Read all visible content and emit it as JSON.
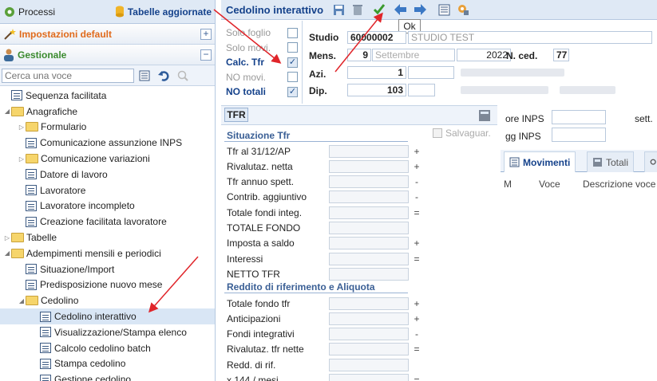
{
  "left": {
    "processi": "Processi",
    "tabelle_aggiornate": "Tabelle aggiornate",
    "sections": [
      {
        "label": "Impostazioni default",
        "color": "#e06a1b",
        "toggle": "+"
      },
      {
        "label": "Gestionale",
        "color": "#3a8a2e",
        "toggle": "−"
      }
    ],
    "search_placeholder": "Cerca una voce",
    "tree": [
      {
        "label": "Sequenza facilitata",
        "type": "doc",
        "level": 0,
        "exp": ""
      },
      {
        "label": "Anagrafiche",
        "type": "folder",
        "level": 0,
        "exp": "◢"
      },
      {
        "label": "Formulario",
        "type": "folder",
        "level": 1,
        "exp": "▷"
      },
      {
        "label": "Comunicazione assunzione INPS",
        "type": "doc",
        "level": 1,
        "exp": ""
      },
      {
        "label": "Comunicazione variazioni",
        "type": "folder",
        "level": 1,
        "exp": "▷"
      },
      {
        "label": "Datore di lavoro",
        "type": "doc",
        "level": 1,
        "exp": ""
      },
      {
        "label": "Lavoratore",
        "type": "doc",
        "level": 1,
        "exp": ""
      },
      {
        "label": "Lavoratore incompleto",
        "type": "doc",
        "level": 1,
        "exp": ""
      },
      {
        "label": "Creazione facilitata lavoratore",
        "type": "doc",
        "level": 1,
        "exp": ""
      },
      {
        "label": "Tabelle",
        "type": "folder",
        "level": 0,
        "exp": "▷"
      },
      {
        "label": "Adempimenti mensili e periodici",
        "type": "folder",
        "level": 0,
        "exp": "◢"
      },
      {
        "label": "Situazione/Import",
        "type": "doc",
        "level": 1,
        "exp": ""
      },
      {
        "label": "Predisposizione nuovo mese",
        "type": "doc",
        "level": 1,
        "exp": ""
      },
      {
        "label": "Cedolino",
        "type": "folder",
        "level": 1,
        "exp": "◢"
      },
      {
        "label": "Cedolino interattivo",
        "type": "doc",
        "level": 2,
        "exp": "",
        "selected": true
      },
      {
        "label": "Visualizzazione/Stampa elenco",
        "type": "doc",
        "level": 2,
        "exp": ""
      },
      {
        "label": "Calcolo cedolino batch",
        "type": "doc",
        "level": 2,
        "exp": ""
      },
      {
        "label": "Stampa cedolino",
        "type": "doc",
        "level": 2,
        "exp": ""
      },
      {
        "label": "Gestione cedolino",
        "type": "doc",
        "level": 2,
        "exp": ""
      }
    ]
  },
  "toolbar": {
    "title": "Cedolino interattivo",
    "tooltip": "Ok"
  },
  "checks": [
    {
      "label": "Solo foglio",
      "checked": false,
      "bold": false
    },
    {
      "label": "Solo movi.",
      "checked": false,
      "bold": false
    },
    {
      "label": "Calc. Tfr",
      "checked": true,
      "bold": true
    },
    {
      "label": "NO movi.",
      "checked": false,
      "bold": false
    },
    {
      "label": "NO totali",
      "checked": true,
      "bold": true
    }
  ],
  "header": {
    "studio_label": "Studio",
    "studio_code": "60000002",
    "studio_name": "STUDIO TEST",
    "mens_label": "Mens.",
    "month_num": "9",
    "month_name": "Settembre",
    "year": "2022",
    "nced_label": "N. ced.",
    "nced": "77",
    "azi_label": "Azi.",
    "azi": "1",
    "dip_label": "Dip.",
    "dip": "103"
  },
  "panel": {
    "tab": "TFR",
    "salvaguar": "Salvaguar.",
    "group1": "Situazione Tfr",
    "rows1": [
      {
        "label": "Tfr al 31/12/AP",
        "op": "+"
      },
      {
        "label": "Rivalutaz. netta",
        "op": "+"
      },
      {
        "label": "Tfr annuo spett.",
        "op": "-"
      },
      {
        "label": "Contrib. aggiuntivo",
        "op": "-"
      },
      {
        "label": "Totale fondi integ.",
        "op": "="
      },
      {
        "label": "TOTALE FONDO",
        "op": ""
      },
      {
        "label": "Imposta a saldo",
        "op": "+"
      },
      {
        "label": "Interessi",
        "op": "="
      },
      {
        "label": "NETTO TFR",
        "op": ""
      }
    ],
    "group2": "Reddito di riferimento e Aliquota",
    "rows2": [
      {
        "label": "Totale fondo tfr",
        "op": "+"
      },
      {
        "label": "Anticipazioni",
        "op": "+"
      },
      {
        "label": "Fondi integrativi",
        "op": "-"
      },
      {
        "label": "Rivalutaz. tfr nette",
        "op": "="
      },
      {
        "label": "Redd. di rif.",
        "op": ""
      },
      {
        "label": "x 144 / mesi",
        "op": "="
      }
    ]
  },
  "rightblock": {
    "ore_inps": "ore INPS",
    "sett": "sett.",
    "gg_inps": "gg INPS",
    "tabs": [
      "Movimenti",
      "Totali"
    ],
    "cols": [
      "M",
      "Voce",
      "Descrizione voce"
    ]
  }
}
